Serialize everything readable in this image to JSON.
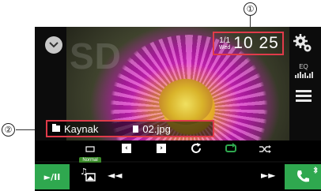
{
  "callouts": {
    "one": "①",
    "two": "②"
  },
  "screen": {
    "watermark": "SD",
    "clock": {
      "date": "1/1",
      "weekday": "Wed",
      "time": "10 25"
    },
    "eq_label": "EQ",
    "info": {
      "folder": "Kaynak",
      "file": "02.jpg"
    },
    "repeat_label": "Normal",
    "transport": {
      "play_pause": "►/II",
      "prev": "◄◄",
      "next": "►►"
    }
  },
  "colors": {
    "highlight": "#e03b4a",
    "accent_green": "#2fa84f"
  },
  "icons": [
    "chevron-down-icon",
    "settings-gears-icon",
    "eq-icon",
    "menu-icon",
    "folder-icon",
    "file-icon",
    "repeat-mode-icon",
    "prev-folder-icon",
    "next-folder-icon",
    "rotate-icon",
    "repeat-icon",
    "shuffle-off-icon",
    "music-photo-switch-icon",
    "phone-icon",
    "bluetooth-icon"
  ]
}
